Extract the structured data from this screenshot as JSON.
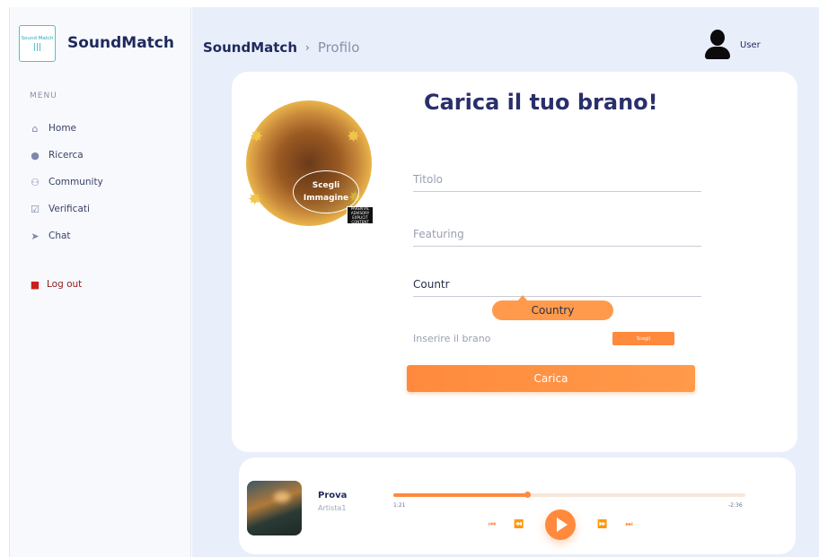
{
  "sidebar": {
    "logo_text": "Sound Match",
    "brand": "SoundMatch",
    "menu_label": "MENU",
    "items": [
      {
        "label": "Home",
        "icon": "home-icon"
      },
      {
        "label": "Ricerca",
        "icon": "search-icon"
      },
      {
        "label": "Community",
        "icon": "people-icon"
      },
      {
        "label": "Verificati",
        "icon": "check-icon"
      },
      {
        "label": "Chat",
        "icon": "send-icon"
      }
    ],
    "logout_label": "Log out"
  },
  "header": {
    "app": "SoundMatch",
    "separator": "›",
    "page": "Profilo",
    "user_label": "User"
  },
  "upload": {
    "title": "Carica il tuo brano!",
    "cover_button": "Scegli Immagine",
    "explicit_badge": "PARENTAL ADVISORY EXPLICIT CONTENT",
    "fields": {
      "title_placeholder": "Titolo",
      "featuring_placeholder": "Featuring",
      "country_value": "Countr"
    },
    "country_suggestion": "Country",
    "song_label": "Inserire il brano",
    "song_button": "Scegli",
    "submit_label": "Carica"
  },
  "player": {
    "track_title": "Prova",
    "track_artist": "Artista1",
    "current_time": "1:21",
    "remaining_time": "-2:36",
    "progress": 0.38
  },
  "colors": {
    "accent": "#ff8a3d",
    "navy": "#1f2a5c",
    "main_bg": "#e9eefb",
    "logout": "#8c1c1c"
  }
}
